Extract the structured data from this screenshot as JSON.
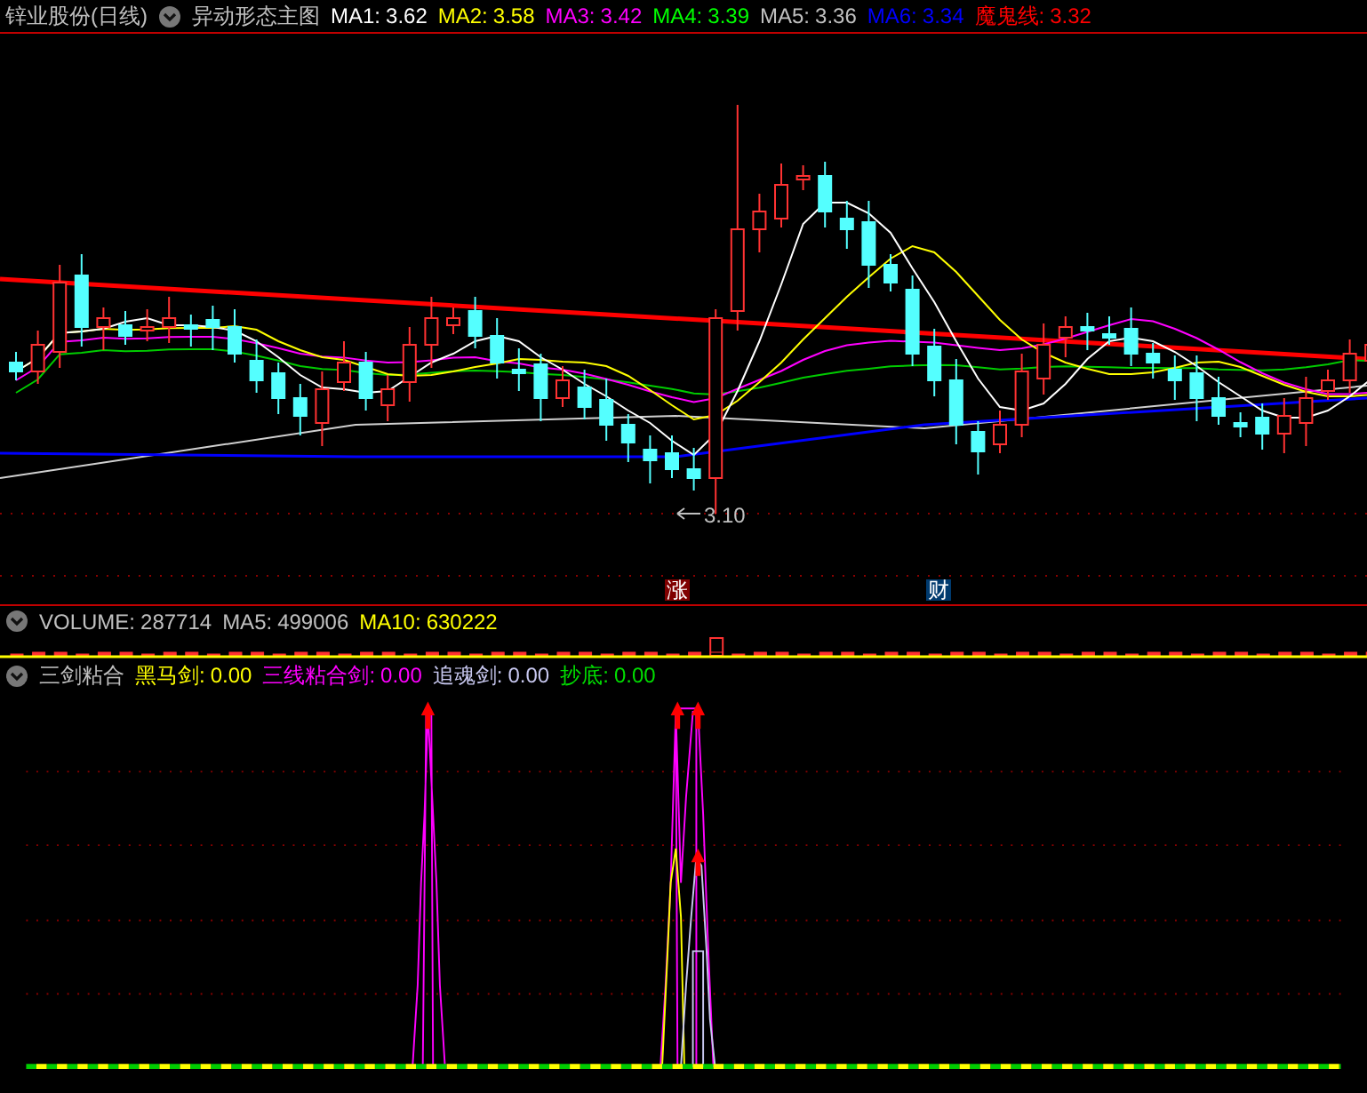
{
  "main_header": {
    "stock": "锌业股份(日线)",
    "indicator": "异动形态主图",
    "ma": [
      {
        "label": "MA1:",
        "value": "3.62",
        "color": "#ffffff"
      },
      {
        "label": "MA2:",
        "value": "3.58",
        "color": "#ffff00"
      },
      {
        "label": "MA3:",
        "value": "3.42",
        "color": "#ff00ff"
      },
      {
        "label": "MA4:",
        "value": "3.39",
        "color": "#00ff00"
      },
      {
        "label": "MA5:",
        "value": "3.36",
        "color": "#c0c0c0"
      },
      {
        "label": "MA6:",
        "value": "3.34",
        "color": "#0000ff"
      },
      {
        "label": "魔鬼线:",
        "value": "3.32",
        "color": "#ff0000"
      }
    ]
  },
  "low_marker": "3.10",
  "event_markers": [
    {
      "text": "涨",
      "color": "#800000"
    },
    {
      "text": "财",
      "color": "#003a6e"
    }
  ],
  "volume_header": {
    "items": [
      {
        "label": "VOLUME:",
        "value": "287714",
        "color": "#c0c0c0"
      },
      {
        "label": "MA5:",
        "value": "499006",
        "color": "#c0c0c0"
      },
      {
        "label": "MA10:",
        "value": "630222",
        "color": "#ffff00"
      }
    ]
  },
  "indicator_header": {
    "name": "三剑粘合",
    "items": [
      {
        "label": "黑马剑:",
        "value": "0.00",
        "color": "#ffff00"
      },
      {
        "label": "三线粘合剑:",
        "value": "0.00",
        "color": "#ff00ff"
      },
      {
        "label": "追魂剑:",
        "value": "0.00",
        "color": "#c8c8f0"
      },
      {
        "label": "抄底:",
        "value": "0.00",
        "color": "#00dd00"
      }
    ]
  }
}
